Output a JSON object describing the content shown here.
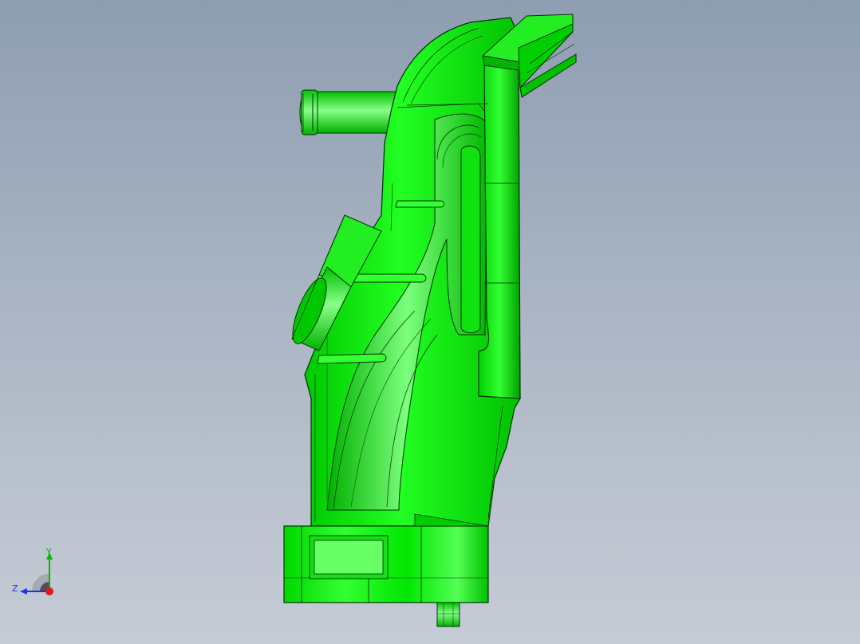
{
  "viewport": {
    "background_top": "#8e9db1",
    "background_bottom": "#c6ccd6"
  },
  "model": {
    "fill_color": "#00ee00",
    "edge_color": "#003300",
    "highlight_color": "#66ff66",
    "shadow_color": "#00a800"
  },
  "triad": {
    "y_label": "Y",
    "z_label": "Z",
    "y_color": "#00bb00",
    "z_color": "#1a35d8",
    "x_color": "#e01818"
  }
}
